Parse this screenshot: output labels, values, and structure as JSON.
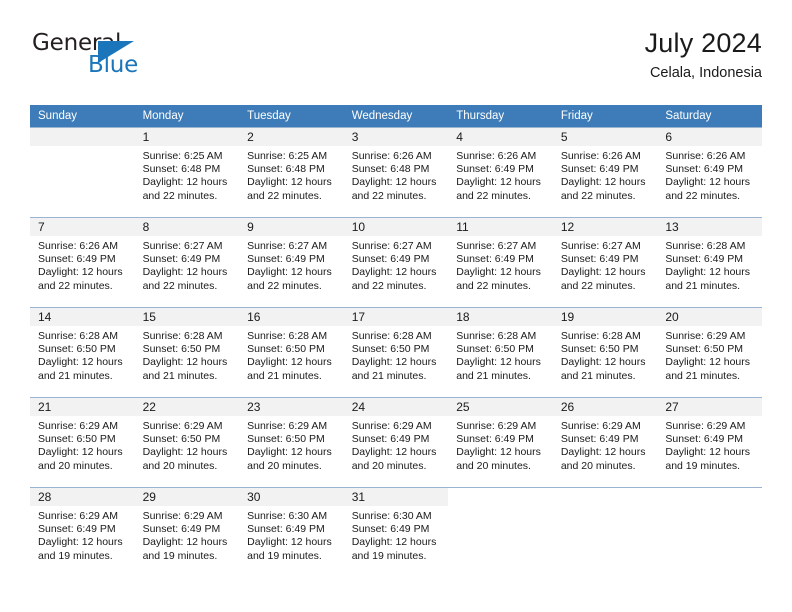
{
  "logo": {
    "word_one": "General",
    "word_two": "Blue",
    "triangle_icon": "triangle-icon",
    "brand_blue": "#1b75bb",
    "brand_dark": "#231f20"
  },
  "header": {
    "title": "July 2024",
    "subtitle": "Celala, Indonesia"
  },
  "calendar": {
    "header_bg": "#3d7cb8",
    "daynum_bg": "#f2f2f2",
    "weekdays": [
      "Sunday",
      "Monday",
      "Tuesday",
      "Wednesday",
      "Thursday",
      "Friday",
      "Saturday"
    ],
    "labels": {
      "sunrise": "Sunrise:",
      "sunset": "Sunset:",
      "daylight": "Daylight:"
    },
    "weeks": [
      [
        {
          "day": "",
          "blank": true
        },
        {
          "day": "1",
          "sunrise": "Sunrise: 6:25 AM",
          "sunset": "Sunset: 6:48 PM",
          "daylight_line1": "Daylight: 12 hours",
          "daylight_line2": "and 22 minutes."
        },
        {
          "day": "2",
          "sunrise": "Sunrise: 6:25 AM",
          "sunset": "Sunset: 6:48 PM",
          "daylight_line1": "Daylight: 12 hours",
          "daylight_line2": "and 22 minutes."
        },
        {
          "day": "3",
          "sunrise": "Sunrise: 6:26 AM",
          "sunset": "Sunset: 6:48 PM",
          "daylight_line1": "Daylight: 12 hours",
          "daylight_line2": "and 22 minutes."
        },
        {
          "day": "4",
          "sunrise": "Sunrise: 6:26 AM",
          "sunset": "Sunset: 6:49 PM",
          "daylight_line1": "Daylight: 12 hours",
          "daylight_line2": "and 22 minutes."
        },
        {
          "day": "5",
          "sunrise": "Sunrise: 6:26 AM",
          "sunset": "Sunset: 6:49 PM",
          "daylight_line1": "Daylight: 12 hours",
          "daylight_line2": "and 22 minutes."
        },
        {
          "day": "6",
          "sunrise": "Sunrise: 6:26 AM",
          "sunset": "Sunset: 6:49 PM",
          "daylight_line1": "Daylight: 12 hours",
          "daylight_line2": "and 22 minutes."
        }
      ],
      [
        {
          "day": "7",
          "sunrise": "Sunrise: 6:26 AM",
          "sunset": "Sunset: 6:49 PM",
          "daylight_line1": "Daylight: 12 hours",
          "daylight_line2": "and 22 minutes."
        },
        {
          "day": "8",
          "sunrise": "Sunrise: 6:27 AM",
          "sunset": "Sunset: 6:49 PM",
          "daylight_line1": "Daylight: 12 hours",
          "daylight_line2": "and 22 minutes."
        },
        {
          "day": "9",
          "sunrise": "Sunrise: 6:27 AM",
          "sunset": "Sunset: 6:49 PM",
          "daylight_line1": "Daylight: 12 hours",
          "daylight_line2": "and 22 minutes."
        },
        {
          "day": "10",
          "sunrise": "Sunrise: 6:27 AM",
          "sunset": "Sunset: 6:49 PM",
          "daylight_line1": "Daylight: 12 hours",
          "daylight_line2": "and 22 minutes."
        },
        {
          "day": "11",
          "sunrise": "Sunrise: 6:27 AM",
          "sunset": "Sunset: 6:49 PM",
          "daylight_line1": "Daylight: 12 hours",
          "daylight_line2": "and 22 minutes."
        },
        {
          "day": "12",
          "sunrise": "Sunrise: 6:27 AM",
          "sunset": "Sunset: 6:49 PM",
          "daylight_line1": "Daylight: 12 hours",
          "daylight_line2": "and 22 minutes."
        },
        {
          "day": "13",
          "sunrise": "Sunrise: 6:28 AM",
          "sunset": "Sunset: 6:49 PM",
          "daylight_line1": "Daylight: 12 hours",
          "daylight_line2": "and 21 minutes."
        }
      ],
      [
        {
          "day": "14",
          "sunrise": "Sunrise: 6:28 AM",
          "sunset": "Sunset: 6:50 PM",
          "daylight_line1": "Daylight: 12 hours",
          "daylight_line2": "and 21 minutes."
        },
        {
          "day": "15",
          "sunrise": "Sunrise: 6:28 AM",
          "sunset": "Sunset: 6:50 PM",
          "daylight_line1": "Daylight: 12 hours",
          "daylight_line2": "and 21 minutes."
        },
        {
          "day": "16",
          "sunrise": "Sunrise: 6:28 AM",
          "sunset": "Sunset: 6:50 PM",
          "daylight_line1": "Daylight: 12 hours",
          "daylight_line2": "and 21 minutes."
        },
        {
          "day": "17",
          "sunrise": "Sunrise: 6:28 AM",
          "sunset": "Sunset: 6:50 PM",
          "daylight_line1": "Daylight: 12 hours",
          "daylight_line2": "and 21 minutes."
        },
        {
          "day": "18",
          "sunrise": "Sunrise: 6:28 AM",
          "sunset": "Sunset: 6:50 PM",
          "daylight_line1": "Daylight: 12 hours",
          "daylight_line2": "and 21 minutes."
        },
        {
          "day": "19",
          "sunrise": "Sunrise: 6:28 AM",
          "sunset": "Sunset: 6:50 PM",
          "daylight_line1": "Daylight: 12 hours",
          "daylight_line2": "and 21 minutes."
        },
        {
          "day": "20",
          "sunrise": "Sunrise: 6:29 AM",
          "sunset": "Sunset: 6:50 PM",
          "daylight_line1": "Daylight: 12 hours",
          "daylight_line2": "and 21 minutes."
        }
      ],
      [
        {
          "day": "21",
          "sunrise": "Sunrise: 6:29 AM",
          "sunset": "Sunset: 6:50 PM",
          "daylight_line1": "Daylight: 12 hours",
          "daylight_line2": "and 20 minutes."
        },
        {
          "day": "22",
          "sunrise": "Sunrise: 6:29 AM",
          "sunset": "Sunset: 6:50 PM",
          "daylight_line1": "Daylight: 12 hours",
          "daylight_line2": "and 20 minutes."
        },
        {
          "day": "23",
          "sunrise": "Sunrise: 6:29 AM",
          "sunset": "Sunset: 6:50 PM",
          "daylight_line1": "Daylight: 12 hours",
          "daylight_line2": "and 20 minutes."
        },
        {
          "day": "24",
          "sunrise": "Sunrise: 6:29 AM",
          "sunset": "Sunset: 6:49 PM",
          "daylight_line1": "Daylight: 12 hours",
          "daylight_line2": "and 20 minutes."
        },
        {
          "day": "25",
          "sunrise": "Sunrise: 6:29 AM",
          "sunset": "Sunset: 6:49 PM",
          "daylight_line1": "Daylight: 12 hours",
          "daylight_line2": "and 20 minutes."
        },
        {
          "day": "26",
          "sunrise": "Sunrise: 6:29 AM",
          "sunset": "Sunset: 6:49 PM",
          "daylight_line1": "Daylight: 12 hours",
          "daylight_line2": "and 20 minutes."
        },
        {
          "day": "27",
          "sunrise": "Sunrise: 6:29 AM",
          "sunset": "Sunset: 6:49 PM",
          "daylight_line1": "Daylight: 12 hours",
          "daylight_line2": "and 19 minutes."
        }
      ],
      [
        {
          "day": "28",
          "sunrise": "Sunrise: 6:29 AM",
          "sunset": "Sunset: 6:49 PM",
          "daylight_line1": "Daylight: 12 hours",
          "daylight_line2": "and 19 minutes."
        },
        {
          "day": "29",
          "sunrise": "Sunrise: 6:29 AM",
          "sunset": "Sunset: 6:49 PM",
          "daylight_line1": "Daylight: 12 hours",
          "daylight_line2": "and 19 minutes."
        },
        {
          "day": "30",
          "sunrise": "Sunrise: 6:30 AM",
          "sunset": "Sunset: 6:49 PM",
          "daylight_line1": "Daylight: 12 hours",
          "daylight_line2": "and 19 minutes."
        },
        {
          "day": "31",
          "sunrise": "Sunrise: 6:30 AM",
          "sunset": "Sunset: 6:49 PM",
          "daylight_line1": "Daylight: 12 hours",
          "daylight_line2": "and 19 minutes."
        },
        {
          "day": "",
          "blank": true
        },
        {
          "day": "",
          "blank": true
        },
        {
          "day": "",
          "blank": true
        }
      ]
    ]
  }
}
